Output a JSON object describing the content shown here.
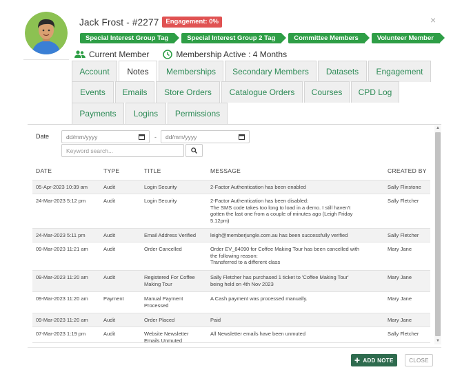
{
  "member": {
    "name": "Jack Frost - #2277",
    "engagement_badge": "Engagement: 0%",
    "tags": [
      "Special Interest Group Tag",
      "Special Interest Group 2 Tag",
      "Committee Members",
      "Volunteer Member"
    ],
    "status": "Current Member",
    "membership": "Membership Active : 4 Months"
  },
  "close_label": "×",
  "tabs": {
    "row1": [
      "Account",
      "Notes",
      "Memberships",
      "Secondary Members",
      "Datasets",
      "Engagement"
    ],
    "row2": [
      "Events",
      "Emails",
      "Store Orders",
      "Catalogue Orders",
      "Courses",
      "CPD Log"
    ],
    "row3": [
      "Payments",
      "Logins",
      "Permissions"
    ],
    "active": "Notes"
  },
  "filters": {
    "date_label": "Date",
    "date_from_placeholder": "dd/mm/yyyy",
    "date_to_placeholder": "dd/mm/yyyy",
    "date_separator": "-",
    "keyword_placeholder": "Keyword search..."
  },
  "table": {
    "headers": {
      "date": "DATE",
      "type": "TYPE",
      "title": "TITLE",
      "message": "MESSAGE",
      "created_by": "CREATED BY"
    },
    "rows": [
      {
        "date": "05-Apr-2023 10:39 am",
        "type": "Audit",
        "title": "Login Security",
        "message": "2-Factor Authentication has been enabled",
        "created_by": "Sally Flinstone"
      },
      {
        "date": "24-Mar-2023 5:12 pm",
        "type": "Audit",
        "title": "Login Security",
        "message": "2-Factor Authentication has been disabled:\nThe SMS code takes too long to load in a demo. I still haven't\ngotten the last one from a couple of minutes ago (Leigh Friday\n5.12pm)",
        "created_by": "Sally Fletcher"
      },
      {
        "date": "24-Mar-2023 5:11 pm",
        "type": "Audit",
        "title": "Email Address Verified",
        "message": "leigh@memberjungle.com.au has been successfully verified",
        "created_by": "Sally Fletcher"
      },
      {
        "date": "09-Mar-2023 11:21 am",
        "type": "Audit",
        "title": "Order Cancelled",
        "message": "Order EV_84090 for Coffee Making Tour has been cancelled with\nthe following reason:\nTransferred to a different class",
        "created_by": "Mary Jane"
      },
      {
        "date": "09-Mar-2023 11:20 am",
        "type": "Audit",
        "title": "Registered For Coffee\nMaking Tour",
        "message": "Sally Fletcher has purchased 1 ticket to 'Coffee Making Tour'\nbeing held on 4th Nov 2023",
        "created_by": "Mary Jane"
      },
      {
        "date": "09-Mar-2023 11:20 am",
        "type": "Payment",
        "title": "Manual Payment\nProcessed",
        "message": "A Cash payment was processed manually.",
        "created_by": "Mary Jane"
      },
      {
        "date": "09-Mar-2023 11:20 am",
        "type": "Audit",
        "title": "Order Placed",
        "message": "Paid",
        "created_by": "Mary Jane"
      },
      {
        "date": "07-Mar-2023 1:19 pm",
        "type": "Audit",
        "title": "Website Newsletter\nEmails Unmuted",
        "message": "All Newsletter emails have been unmuted",
        "created_by": "Sally Fletcher"
      }
    ]
  },
  "footer": {
    "add_note": "ADD NOTE",
    "close": "CLOSE"
  },
  "colors": {
    "accent": "#2e9e46",
    "tab_text": "#2e8b57",
    "badge": "#e05252",
    "primary_button": "#2e6b4e"
  },
  "icons": {
    "member": "users-icon",
    "membership": "clock-icon",
    "search": "search-icon",
    "calendar": "calendar-icon",
    "add": "plus-icon"
  }
}
